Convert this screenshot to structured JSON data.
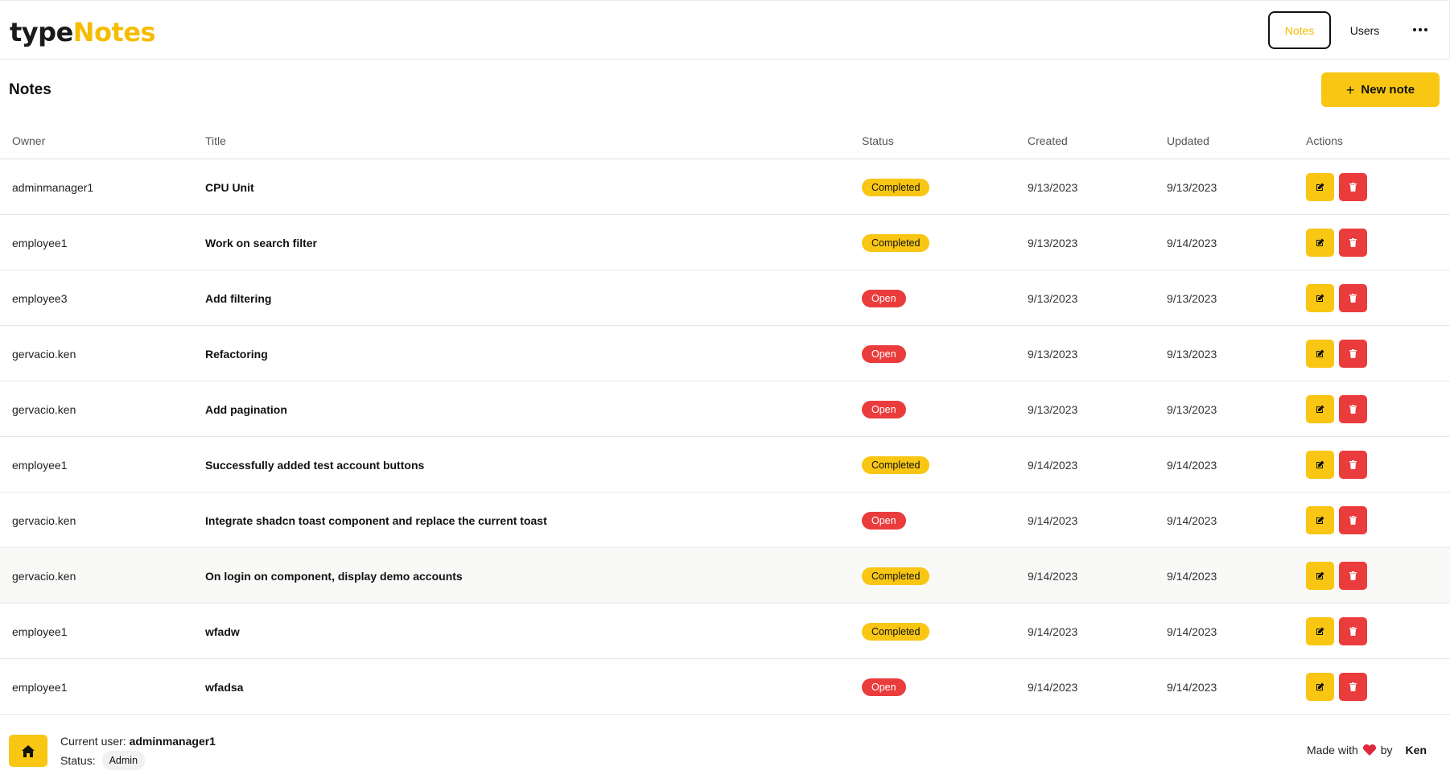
{
  "header": {
    "logo_part1": "type",
    "logo_part2": "Notes",
    "nav": {
      "notes": "Notes",
      "users": "Users"
    }
  },
  "page": {
    "title": "Notes",
    "new_button": "New note"
  },
  "table": {
    "columns": {
      "owner": "Owner",
      "title": "Title",
      "status": "Status",
      "created": "Created",
      "updated": "Updated",
      "actions": "Actions"
    },
    "rows": [
      {
        "owner": "adminmanager1",
        "title": "CPU Unit",
        "status": "Completed",
        "created": "9/13/2023",
        "updated": "9/13/2023"
      },
      {
        "owner": "employee1",
        "title": "Work on search filter",
        "status": "Completed",
        "created": "9/13/2023",
        "updated": "9/14/2023"
      },
      {
        "owner": "employee3",
        "title": "Add filtering",
        "status": "Open",
        "created": "9/13/2023",
        "updated": "9/13/2023"
      },
      {
        "owner": "gervacio.ken",
        "title": "Refactoring",
        "status": "Open",
        "created": "9/13/2023",
        "updated": "9/13/2023"
      },
      {
        "owner": "gervacio.ken",
        "title": "Add pagination",
        "status": "Open",
        "created": "9/13/2023",
        "updated": "9/13/2023"
      },
      {
        "owner": "employee1",
        "title": "Successfully added test account buttons",
        "status": "Completed",
        "created": "9/14/2023",
        "updated": "9/14/2023"
      },
      {
        "owner": "gervacio.ken",
        "title": "Integrate shadcn toast component and replace the current toast",
        "status": "Open",
        "created": "9/14/2023",
        "updated": "9/14/2023"
      },
      {
        "owner": "gervacio.ken",
        "title": "On login on component, display demo accounts",
        "status": "Completed",
        "created": "9/14/2023",
        "updated": "9/14/2023"
      },
      {
        "owner": "employee1",
        "title": "wfadw",
        "status": "Completed",
        "created": "9/14/2023",
        "updated": "9/14/2023"
      },
      {
        "owner": "employee1",
        "title": "wfadsa",
        "status": "Open",
        "created": "9/14/2023",
        "updated": "9/14/2023"
      }
    ]
  },
  "footer": {
    "current_user_label": "Current user:",
    "current_user": "adminmanager1",
    "status_label": "Status:",
    "role": "Admin",
    "made_with": "Made with",
    "by": "by",
    "author": "Ken"
  },
  "colors": {
    "accent": "#f8c613",
    "danger": "#ea3c3c",
    "logo_accent": "#f5bc00"
  },
  "icons": [
    "more-horizontal-icon",
    "plus-icon",
    "edit-icon",
    "trash-icon",
    "home-icon",
    "heart-icon"
  ]
}
